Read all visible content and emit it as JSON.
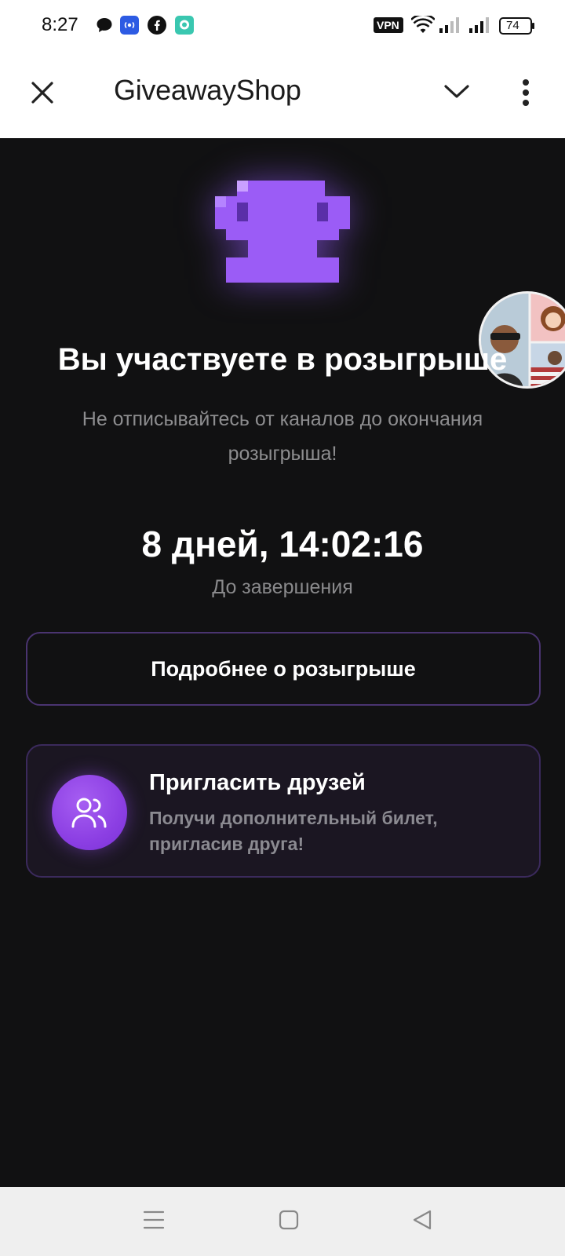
{
  "status_bar": {
    "time": "8:27",
    "app_icons": [
      "messenger-bubble-icon",
      "podcast-icon",
      "facebook-icon",
      "chat-icon"
    ],
    "vpn_label": "VPN",
    "battery_level": "74"
  },
  "header": {
    "title": "GiveawayShop",
    "close_icon": "close-icon",
    "collapse_icon": "chevron-down-icon",
    "menu_icon": "more-vertical-icon"
  },
  "main": {
    "title": "Вы участвуете в розыгрыше",
    "subtitle": "Не отписывайтесь от каналов до окончания розыгрыша!",
    "countdown": "8 дней, 14:02:16",
    "countdown_label": "До завершения",
    "details_button": "Подробнее о розыгрыше",
    "invite": {
      "title": "Пригласить друзей",
      "description": "Получи дополнительный билет, пригласив друга!"
    }
  },
  "colors": {
    "accent": "#8c3fe3",
    "trophy": "#9b5cf6",
    "background": "#111112"
  }
}
